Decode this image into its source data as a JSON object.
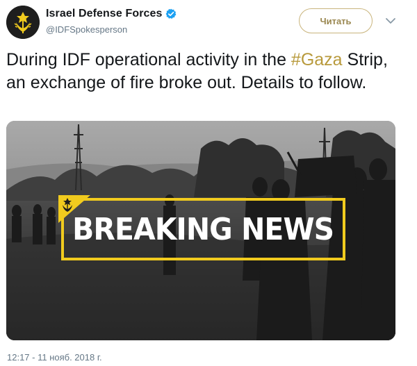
{
  "author": {
    "display_name": "Israel Defense Forces",
    "handle": "@IDFSpokesperson",
    "verified": true,
    "avatar_icon": "idf-emblem-icon"
  },
  "follow_button": {
    "label": "Читать"
  },
  "menu": {
    "icon": "chevron-down-icon"
  },
  "tweet": {
    "text_before": "During IDF operational activity in the ",
    "hashtag": "#Gaza",
    "text_after": " Strip, an exchange of fire broke out. Details to follow."
  },
  "media": {
    "headline": "BREAKING NEWS",
    "accent_color": "#f1cb1e",
    "logo_icon": "idf-emblem-icon"
  },
  "timestamp": "12:17 - 11 нояб. 2018 г.",
  "colors": {
    "hashtag": "#b89a3c",
    "follow_border": "#c9b47c",
    "verified": "#1da1f2",
    "meta_text": "#657786"
  }
}
